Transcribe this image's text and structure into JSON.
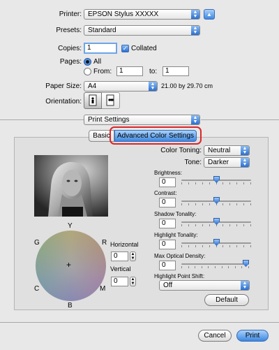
{
  "printer": {
    "label": "Printer:",
    "value": "EPSON Stylus XXXXX"
  },
  "presets": {
    "label": "Presets:",
    "value": "Standard"
  },
  "copies": {
    "label": "Copies:",
    "value": "1",
    "collated_label": "Collated",
    "collated": true
  },
  "pages": {
    "label": "Pages:",
    "all_label": "All",
    "from_label": "From:",
    "from_value": "1",
    "to_label": "to:",
    "to_value": "1",
    "selected": "All"
  },
  "paper_size": {
    "label": "Paper Size:",
    "value": "A4",
    "dimensions": "21.00 by 29.70 cm"
  },
  "orientation": {
    "label": "Orientation:"
  },
  "section": {
    "value": "Print Settings"
  },
  "tabs": [
    {
      "label": "Basic"
    },
    {
      "label": "Advanced Color Settings",
      "selected": true
    }
  ],
  "color": {
    "toning_label": "Color Toning:",
    "toning_value": "Neutral",
    "tone_label": "Tone:",
    "tone_value": "Darker",
    "sliders": [
      {
        "label": "Brightness:",
        "value": "0",
        "level": 0.5
      },
      {
        "label": "Contrast:",
        "value": "0",
        "level": 0.5
      },
      {
        "label": "Shadow Tonality:",
        "value": "0",
        "level": 0.5
      },
      {
        "label": "Highlight Tonality:",
        "value": "0",
        "level": 0.5
      },
      {
        "label": "Max Optical Density:",
        "value": "0",
        "level": 1.0
      }
    ],
    "highlight_shift_label": "Highlight Point Shift:",
    "highlight_shift_value": "Off",
    "default_label": "Default"
  },
  "wheel": {
    "labels": {
      "Y": "Y",
      "G": "G",
      "R": "R",
      "C": "C",
      "M": "M",
      "B": "B"
    },
    "horizontal_label": "Horizontal",
    "horizontal_value": "0",
    "vertical_label": "Vertical",
    "vertical_value": "0"
  },
  "buttons": {
    "cancel": "Cancel",
    "print": "Print"
  },
  "colors": {
    "accent": "#2a6fd1",
    "highlight_ring": "#d9262a"
  }
}
